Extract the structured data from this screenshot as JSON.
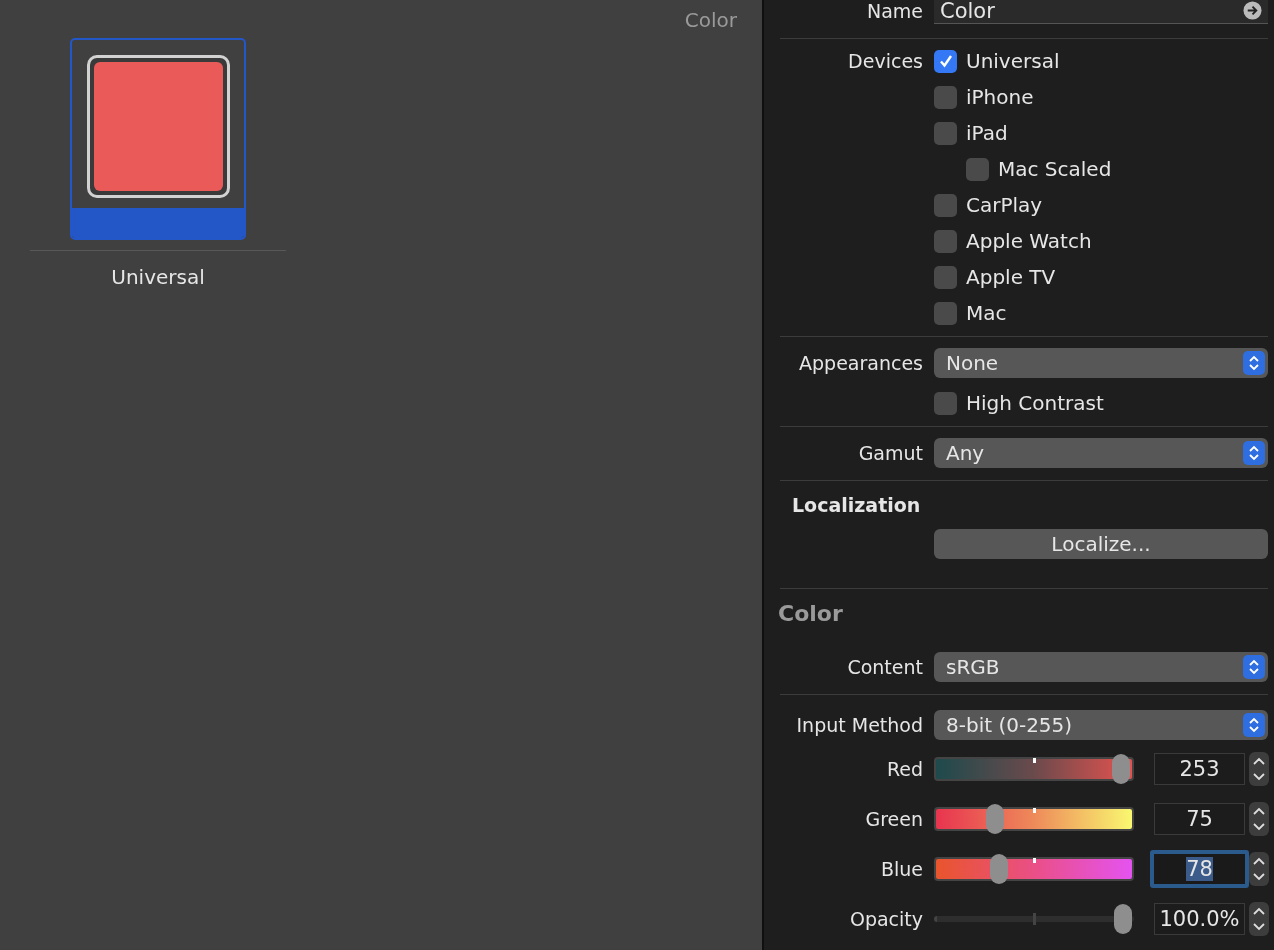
{
  "canvas": {
    "header": "Color",
    "swatch": {
      "label": "Universal",
      "selected": true
    }
  },
  "inspector": {
    "name": {
      "label": "Name",
      "value": "Color"
    },
    "devices": {
      "label": "Devices",
      "items": [
        {
          "label": "Universal",
          "checked": true
        },
        {
          "label": "iPhone",
          "checked": false
        },
        {
          "label": "iPad",
          "checked": false,
          "children": [
            {
              "label": "Mac Scaled",
              "checked": false
            }
          ]
        },
        {
          "label": "CarPlay",
          "checked": false
        },
        {
          "label": "Apple Watch",
          "checked": false
        },
        {
          "label": "Apple TV",
          "checked": false
        },
        {
          "label": "Mac",
          "checked": false
        }
      ]
    },
    "appearances": {
      "label": "Appearances",
      "value": "None"
    },
    "high_contrast": {
      "label": "High Contrast",
      "checked": false
    },
    "gamut": {
      "label": "Gamut",
      "value": "Any"
    },
    "localization": {
      "title": "Localization",
      "button": "Localize..."
    },
    "color": {
      "title": "Color",
      "content": {
        "label": "Content",
        "value": "sRGB"
      },
      "input_method": {
        "label": "Input Method",
        "value": "8-bit (0-255)"
      },
      "sliders": [
        {
          "kind": "red",
          "label": "Red",
          "level": 0.99,
          "value": "253",
          "focused": false
        },
        {
          "kind": "green",
          "label": "Green",
          "level": 0.29,
          "value": "75",
          "focused": false
        },
        {
          "kind": "blue",
          "label": "Blue",
          "level": 0.31,
          "value": "78",
          "focused": true
        },
        {
          "kind": "opacity",
          "label": "Opacity",
          "level": 1.0,
          "value": "100.0%",
          "focused": false
        }
      ]
    }
  }
}
